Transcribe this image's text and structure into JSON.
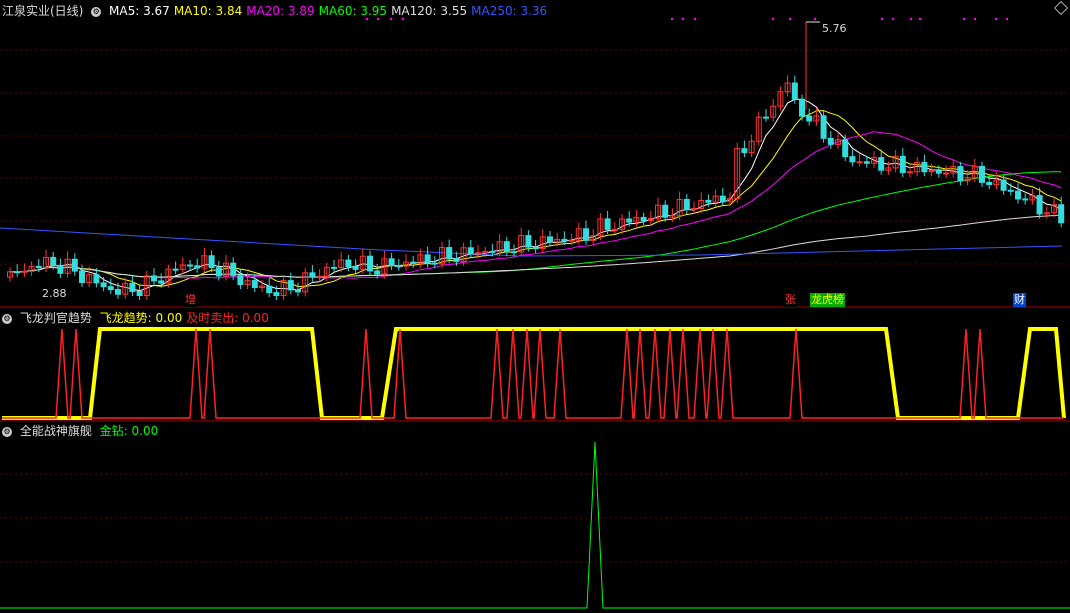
{
  "main_panel": {
    "title": "江泉实业(日线)",
    "ma_items": [
      {
        "label": "MA5: 3.67",
        "color": "#ffffff"
      },
      {
        "label": "MA10: 3.84",
        "color": "#ffff00"
      },
      {
        "label": "MA20: 3.89",
        "color": "#ff00ff"
      },
      {
        "label": "MA60: 3.95",
        "color": "#00ff00"
      },
      {
        "label": "MA120: 3.55",
        "color": "#dddddd"
      },
      {
        "label": "MA250: 3.36",
        "color": "#3355ff"
      }
    ],
    "high_label": "5.76",
    "low_label": "2.88",
    "markers": [
      {
        "text": "增",
        "color": "#ff3333",
        "bg": "#000000"
      },
      {
        "text": "张",
        "color": "#ff3333",
        "bg": "#000000"
      },
      {
        "text": "龙虎榜",
        "color": "#ffff00",
        "bg": "#00aa00"
      },
      {
        "text": "财",
        "color": "#ffffff",
        "bg": "#0044cc"
      }
    ]
  },
  "panel2": {
    "title": "飞龙判官趋势",
    "items": [
      {
        "label": "飞龙趋势: 0.00",
        "color": "#ffff00"
      },
      {
        "label": "及时卖出: 0.00",
        "color": "#ff2222"
      }
    ]
  },
  "panel3": {
    "title": "全能战神旗舰",
    "items": [
      {
        "label": "金钻: 0.00",
        "color": "#00ff00"
      }
    ]
  },
  "colors": {
    "up": "#ff3333",
    "down": "#33dddd",
    "grid": "#660000",
    "border": "#aa0000"
  }
}
